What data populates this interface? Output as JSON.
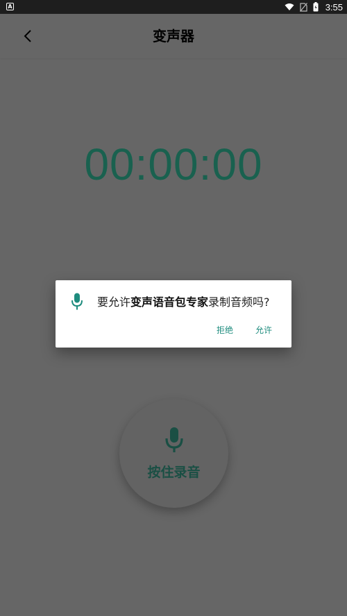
{
  "status_bar": {
    "left_icon_letter": "A",
    "time": "3:55"
  },
  "toolbar": {
    "title": "变声器"
  },
  "timer": {
    "value": "00:00:00"
  },
  "record": {
    "label": "按住录音"
  },
  "dialog": {
    "message_prefix": "要允许",
    "app_name": "变声语音包专家",
    "message_suffix": "录制音频吗?",
    "deny_label": "拒绝",
    "allow_label": "允许"
  },
  "colors": {
    "scrim_background": "#666666",
    "timer_text": "#19614f",
    "dialog_accent": "#1e8c7e",
    "record_accent": "#1a4f44"
  }
}
